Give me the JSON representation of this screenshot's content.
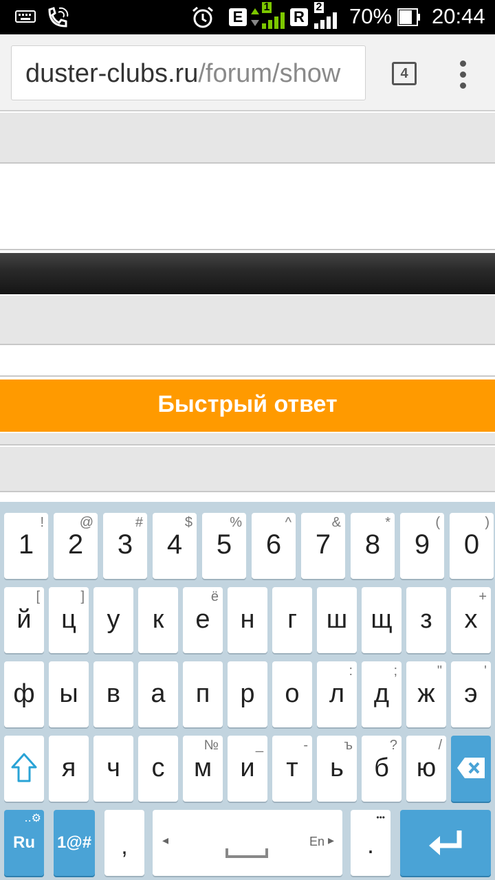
{
  "status_bar": {
    "battery_percent": "70%",
    "time": "20:44",
    "network_1_type": "E",
    "network_1_slot": "1",
    "network_2_type": "R",
    "network_2_slot": "2"
  },
  "browser": {
    "url_host": "duster-clubs.ru",
    "url_path": "/forum/show",
    "tab_count": "4"
  },
  "page": {
    "quick_reply_label": "Быстрый ответ"
  },
  "keyboard": {
    "rows": [
      [
        {
          "main": "1",
          "hint": "!"
        },
        {
          "main": "2",
          "hint": "@"
        },
        {
          "main": "3",
          "hint": "#"
        },
        {
          "main": "4",
          "hint": "$"
        },
        {
          "main": "5",
          "hint": "%"
        },
        {
          "main": "6",
          "hint": "^"
        },
        {
          "main": "7",
          "hint": "&"
        },
        {
          "main": "8",
          "hint": "*"
        },
        {
          "main": "9",
          "hint": "("
        },
        {
          "main": "0",
          "hint": ")"
        }
      ],
      [
        {
          "main": "й",
          "hint": "["
        },
        {
          "main": "ц",
          "hint": "]"
        },
        {
          "main": "у",
          "hint": ""
        },
        {
          "main": "к",
          "hint": ""
        },
        {
          "main": "е",
          "hint": "ё"
        },
        {
          "main": "н",
          "hint": ""
        },
        {
          "main": "г",
          "hint": ""
        },
        {
          "main": "ш",
          "hint": ""
        },
        {
          "main": "щ",
          "hint": ""
        },
        {
          "main": "з",
          "hint": ""
        },
        {
          "main": "х",
          "hint": "+"
        }
      ],
      [
        {
          "main": "ф",
          "hint": ""
        },
        {
          "main": "ы",
          "hint": ""
        },
        {
          "main": "в",
          "hint": ""
        },
        {
          "main": "а",
          "hint": ""
        },
        {
          "main": "п",
          "hint": ""
        },
        {
          "main": "р",
          "hint": ""
        },
        {
          "main": "о",
          "hint": ""
        },
        {
          "main": "л",
          "hint": ":"
        },
        {
          "main": "д",
          "hint": ";"
        },
        {
          "main": "ж",
          "hint": "\""
        },
        {
          "main": "э",
          "hint": "'"
        }
      ],
      [
        {
          "main": "я",
          "hint": ""
        },
        {
          "main": "ч",
          "hint": ""
        },
        {
          "main": "с",
          "hint": ""
        },
        {
          "main": "м",
          "hint": "№"
        },
        {
          "main": "и",
          "hint": "_"
        },
        {
          "main": "т",
          "hint": "-"
        },
        {
          "main": "ь",
          "hint": "ъ"
        },
        {
          "main": "б",
          "hint": "?"
        },
        {
          "main": "ю",
          "hint": "/"
        }
      ]
    ],
    "lang_key": "Ru",
    "symbols_key": "1@#",
    "comma_key": ",",
    "space_lang_hint": "En",
    "period_key": ".",
    "period_hint": "•••"
  },
  "colors": {
    "accent_orange": "#ff9a00",
    "keyboard_bg": "#c2d4df",
    "key_blue": "#4aa3d6",
    "status_green": "#7cc700"
  },
  "icons": [
    "keyboard-icon",
    "phone-call-icon",
    "alarm-icon",
    "signal-icon",
    "battery-icon",
    "tabs-icon",
    "overflow-menu-icon",
    "shift-icon",
    "backspace-icon",
    "enter-icon",
    "settings-gear-icon",
    "space-icon"
  ]
}
